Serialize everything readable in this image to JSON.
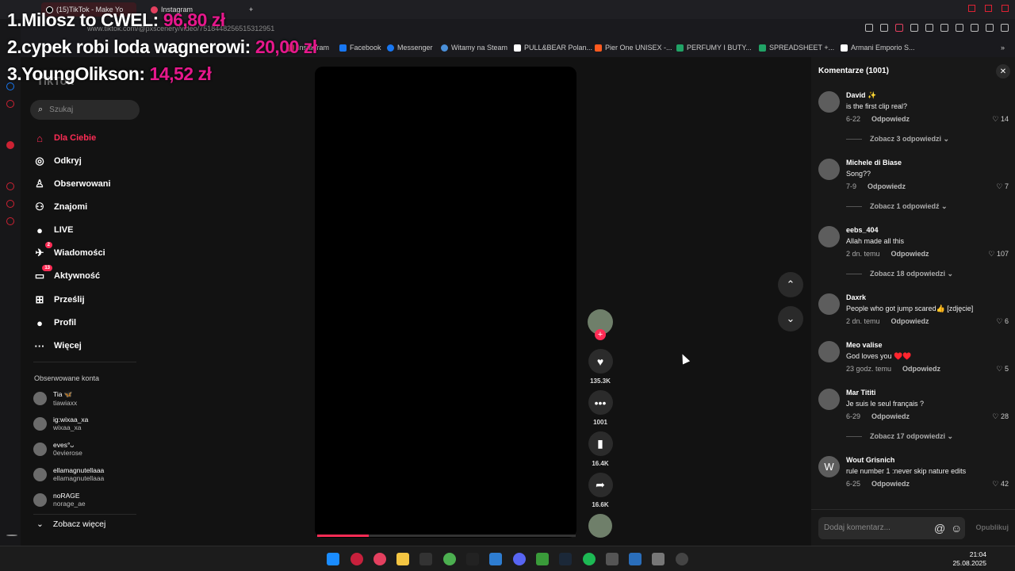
{
  "browser": {
    "tabs": [
      {
        "label": "(15)TikTok - Make Yo",
        "active": true
      },
      {
        "label": "Instagram",
        "active": false
      }
    ],
    "new_tab": "+",
    "url": "www.tiktok.com/@pxscenery/video/7518448256515312951",
    "bookmarks": [
      {
        "label": "Instagram",
        "color": "#e4405f"
      },
      {
        "label": "Facebook",
        "color": "#1877f2"
      },
      {
        "label": "Messenger",
        "color": "#1877f2"
      },
      {
        "label": "Witamy na Steam",
        "color": "#4a90d9"
      },
      {
        "label": "PULL&BEAR Polan...",
        "color": "#ffffff"
      },
      {
        "label": "Pier One UNISEX -...",
        "color": "#ff5a1f"
      },
      {
        "label": "PERFUMY I BUTY...",
        "color": "#21a366"
      },
      {
        "label": "SPREADSHEET +...",
        "color": "#21a366"
      },
      {
        "label": "Armani Emporio S...",
        "color": "#ffffff"
      }
    ]
  },
  "overlay": [
    {
      "label": "1.Milosz to CWEL:",
      "amount": "96,80 zł"
    },
    {
      "label": "2.cypek robi loda wagnerowi:",
      "amount": "20,00 zł"
    },
    {
      "label": "3.YoungOlikson:",
      "amount": "14,52 zł"
    }
  ],
  "sidebar": {
    "logo": "TikTok",
    "search_placeholder": "Szukaj",
    "nav": [
      {
        "label": "Dla Ciebie",
        "icon": "home-icon",
        "glyph": "⌂",
        "active": true,
        "badge": ""
      },
      {
        "label": "Odkryj",
        "icon": "compass-icon",
        "glyph": "◎",
        "active": false,
        "badge": ""
      },
      {
        "label": "Obserwowani",
        "icon": "user-follow-icon",
        "glyph": "♙",
        "active": false,
        "badge": ""
      },
      {
        "label": "Znajomi",
        "icon": "friends-icon",
        "glyph": "⚇",
        "active": false,
        "badge": ""
      },
      {
        "label": "LIVE",
        "icon": "live-avatar-icon",
        "glyph": "●",
        "active": false,
        "badge": ""
      },
      {
        "label": "Wiadomości",
        "icon": "message-icon",
        "glyph": "✈",
        "active": false,
        "badge": "2"
      },
      {
        "label": "Aktywność",
        "icon": "activity-icon",
        "glyph": "▭",
        "active": false,
        "badge": "13"
      },
      {
        "label": "Prześlij",
        "icon": "upload-icon",
        "glyph": "⊞",
        "active": false,
        "badge": ""
      },
      {
        "label": "Profil",
        "icon": "profile-avatar-icon",
        "glyph": "●",
        "active": false,
        "badge": ""
      },
      {
        "label": "Więcej",
        "icon": "more-icon",
        "glyph": "···",
        "active": false,
        "badge": ""
      }
    ],
    "following_title": "Obserwowane konta",
    "following": [
      {
        "name": "Tia 🦋",
        "handle": "tiawiaxx"
      },
      {
        "name": "ig:wixaa_xa",
        "handle": "wixaa_xa"
      },
      {
        "name": "eves°ᴗ",
        "handle": "0evierose"
      },
      {
        "name": "ellamagnutellaaa",
        "handle": "ellamagnutellaaa"
      },
      {
        "name": "noRAGE",
        "handle": "norage_ae"
      }
    ],
    "see_more": "Zobacz więcej"
  },
  "video": {
    "progress": 0.2,
    "likes": "135.3K",
    "comments": "1001",
    "saves": "16.4K",
    "shares": "16.6K"
  },
  "comments_panel": {
    "title": "Komentarze (1001)",
    "reply_label": "Odpowiedz",
    "input_placeholder": "Dodaj komentarz...",
    "publish": "Opublikuj",
    "items": [
      {
        "name": "David ✨",
        "text": "is the first clip real?",
        "time": "6-22",
        "likes": "14",
        "replies": "Zobacz 3 odpowiedzi",
        "initial": ""
      },
      {
        "name": "Michele di Biase",
        "text": "Song??",
        "time": "7-9",
        "likes": "7",
        "replies": "Zobacz 1 odpowiedź",
        "initial": ""
      },
      {
        "name": "eebs_404",
        "text": "Allah made all this",
        "time": "2 dn. temu",
        "likes": "107",
        "replies": "Zobacz 18 odpowiedzi",
        "initial": ""
      },
      {
        "name": "Daxrk",
        "text": "People who got jump scared👍 [zdjęcie]",
        "time": "2 dn. temu",
        "likes": "6",
        "replies": "",
        "initial": ""
      },
      {
        "name": "Meo valise",
        "text": "God loves you ♥️♥️",
        "time": "23 godz. temu",
        "likes": "5",
        "replies": "",
        "initial": ""
      },
      {
        "name": "Mar Tititi",
        "text": "Je suis le seul français ?",
        "time": "6-29",
        "likes": "28",
        "replies": "Zobacz 17 odpowiedzi",
        "initial": ""
      },
      {
        "name": "Wout Grisnich",
        "text": "rule number 1 :never skip nature edits",
        "time": "6-25",
        "likes": "42",
        "replies": "",
        "initial": "W"
      }
    ]
  },
  "taskbar": {
    "time": "21:04",
    "date": "25.08.2025"
  }
}
